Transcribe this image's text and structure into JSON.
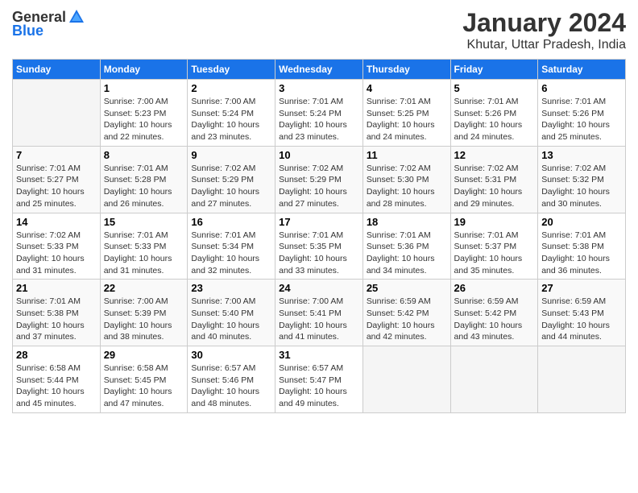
{
  "logo": {
    "general": "General",
    "blue": "Blue"
  },
  "title": "January 2024",
  "subtitle": "Khutar, Uttar Pradesh, India",
  "days_header": [
    "Sunday",
    "Monday",
    "Tuesday",
    "Wednesday",
    "Thursday",
    "Friday",
    "Saturday"
  ],
  "weeks": [
    [
      {
        "num": "",
        "info": ""
      },
      {
        "num": "1",
        "info": "Sunrise: 7:00 AM\nSunset: 5:23 PM\nDaylight: 10 hours\nand 22 minutes."
      },
      {
        "num": "2",
        "info": "Sunrise: 7:00 AM\nSunset: 5:24 PM\nDaylight: 10 hours\nand 23 minutes."
      },
      {
        "num": "3",
        "info": "Sunrise: 7:01 AM\nSunset: 5:24 PM\nDaylight: 10 hours\nand 23 minutes."
      },
      {
        "num": "4",
        "info": "Sunrise: 7:01 AM\nSunset: 5:25 PM\nDaylight: 10 hours\nand 24 minutes."
      },
      {
        "num": "5",
        "info": "Sunrise: 7:01 AM\nSunset: 5:26 PM\nDaylight: 10 hours\nand 24 minutes."
      },
      {
        "num": "6",
        "info": "Sunrise: 7:01 AM\nSunset: 5:26 PM\nDaylight: 10 hours\nand 25 minutes."
      }
    ],
    [
      {
        "num": "7",
        "info": "Sunrise: 7:01 AM\nSunset: 5:27 PM\nDaylight: 10 hours\nand 25 minutes."
      },
      {
        "num": "8",
        "info": "Sunrise: 7:01 AM\nSunset: 5:28 PM\nDaylight: 10 hours\nand 26 minutes."
      },
      {
        "num": "9",
        "info": "Sunrise: 7:02 AM\nSunset: 5:29 PM\nDaylight: 10 hours\nand 27 minutes."
      },
      {
        "num": "10",
        "info": "Sunrise: 7:02 AM\nSunset: 5:29 PM\nDaylight: 10 hours\nand 27 minutes."
      },
      {
        "num": "11",
        "info": "Sunrise: 7:02 AM\nSunset: 5:30 PM\nDaylight: 10 hours\nand 28 minutes."
      },
      {
        "num": "12",
        "info": "Sunrise: 7:02 AM\nSunset: 5:31 PM\nDaylight: 10 hours\nand 29 minutes."
      },
      {
        "num": "13",
        "info": "Sunrise: 7:02 AM\nSunset: 5:32 PM\nDaylight: 10 hours\nand 30 minutes."
      }
    ],
    [
      {
        "num": "14",
        "info": "Sunrise: 7:02 AM\nSunset: 5:33 PM\nDaylight: 10 hours\nand 31 minutes."
      },
      {
        "num": "15",
        "info": "Sunrise: 7:01 AM\nSunset: 5:33 PM\nDaylight: 10 hours\nand 31 minutes."
      },
      {
        "num": "16",
        "info": "Sunrise: 7:01 AM\nSunset: 5:34 PM\nDaylight: 10 hours\nand 32 minutes."
      },
      {
        "num": "17",
        "info": "Sunrise: 7:01 AM\nSunset: 5:35 PM\nDaylight: 10 hours\nand 33 minutes."
      },
      {
        "num": "18",
        "info": "Sunrise: 7:01 AM\nSunset: 5:36 PM\nDaylight: 10 hours\nand 34 minutes."
      },
      {
        "num": "19",
        "info": "Sunrise: 7:01 AM\nSunset: 5:37 PM\nDaylight: 10 hours\nand 35 minutes."
      },
      {
        "num": "20",
        "info": "Sunrise: 7:01 AM\nSunset: 5:38 PM\nDaylight: 10 hours\nand 36 minutes."
      }
    ],
    [
      {
        "num": "21",
        "info": "Sunrise: 7:01 AM\nSunset: 5:38 PM\nDaylight: 10 hours\nand 37 minutes."
      },
      {
        "num": "22",
        "info": "Sunrise: 7:00 AM\nSunset: 5:39 PM\nDaylight: 10 hours\nand 38 minutes."
      },
      {
        "num": "23",
        "info": "Sunrise: 7:00 AM\nSunset: 5:40 PM\nDaylight: 10 hours\nand 40 minutes."
      },
      {
        "num": "24",
        "info": "Sunrise: 7:00 AM\nSunset: 5:41 PM\nDaylight: 10 hours\nand 41 minutes."
      },
      {
        "num": "25",
        "info": "Sunrise: 6:59 AM\nSunset: 5:42 PM\nDaylight: 10 hours\nand 42 minutes."
      },
      {
        "num": "26",
        "info": "Sunrise: 6:59 AM\nSunset: 5:42 PM\nDaylight: 10 hours\nand 43 minutes."
      },
      {
        "num": "27",
        "info": "Sunrise: 6:59 AM\nSunset: 5:43 PM\nDaylight: 10 hours\nand 44 minutes."
      }
    ],
    [
      {
        "num": "28",
        "info": "Sunrise: 6:58 AM\nSunset: 5:44 PM\nDaylight: 10 hours\nand 45 minutes."
      },
      {
        "num": "29",
        "info": "Sunrise: 6:58 AM\nSunset: 5:45 PM\nDaylight: 10 hours\nand 47 minutes."
      },
      {
        "num": "30",
        "info": "Sunrise: 6:57 AM\nSunset: 5:46 PM\nDaylight: 10 hours\nand 48 minutes."
      },
      {
        "num": "31",
        "info": "Sunrise: 6:57 AM\nSunset: 5:47 PM\nDaylight: 10 hours\nand 49 minutes."
      },
      {
        "num": "",
        "info": ""
      },
      {
        "num": "",
        "info": ""
      },
      {
        "num": "",
        "info": ""
      }
    ]
  ]
}
